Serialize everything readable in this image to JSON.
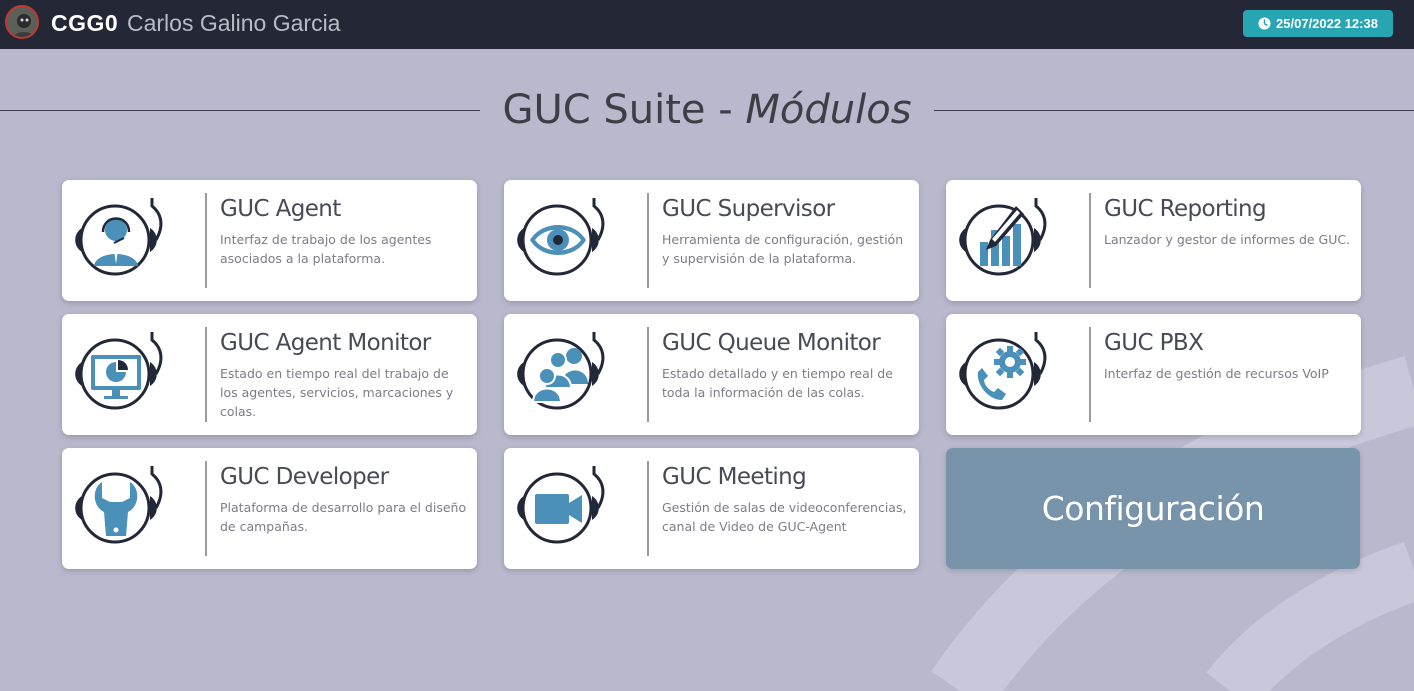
{
  "header": {
    "user_code": "CGG0",
    "user_name": "Carlos Galino Garcia",
    "datetime": "25/07/2022 12:38"
  },
  "page": {
    "title_plain": "GUC Suite - ",
    "title_emphasis": "Módulos"
  },
  "modules": [
    {
      "title": "GUC Agent",
      "description": "Interfaz de trabajo de los agentes asociados a la plataforma.",
      "icon": "agent-headset-icon"
    },
    {
      "title": "GUC Supervisor",
      "description": "Herramienta de configuración, gestión y supervisión de la plataforma.",
      "icon": "eye-icon"
    },
    {
      "title": "GUC Reporting",
      "description": "Lanzador y gestor de informes de GUC.",
      "icon": "chart-pencil-icon"
    },
    {
      "title": "GUC Agent Monitor",
      "description": "Estado en tiempo real del trabajo de los agentes, servicios, marcaciones y colas.",
      "icon": "monitor-chart-icon"
    },
    {
      "title": "GUC Queue Monitor",
      "description": "Estado detallado y en tiempo real de toda la información de las colas.",
      "icon": "users-group-icon"
    },
    {
      "title": "GUC PBX",
      "description": "Interfaz de gestión de recursos VoIP",
      "icon": "phone-gear-icon"
    },
    {
      "title": "GUC Developer",
      "description": "Plataforma de desarrollo para el diseño de campañas.",
      "icon": "wrench-icon"
    },
    {
      "title": "GUC Meeting",
      "description": "Gestión de salas de videoconferencias, canal de Video de GUC-Agent",
      "icon": "video-camera-icon"
    }
  ],
  "config": {
    "label": "Configuración"
  },
  "colors": {
    "topbar": "#242836",
    "background": "#b9b8cd",
    "accent": "#27a5b3",
    "icon_blue": "#4a90b8",
    "config_tile": "#7894aa"
  }
}
